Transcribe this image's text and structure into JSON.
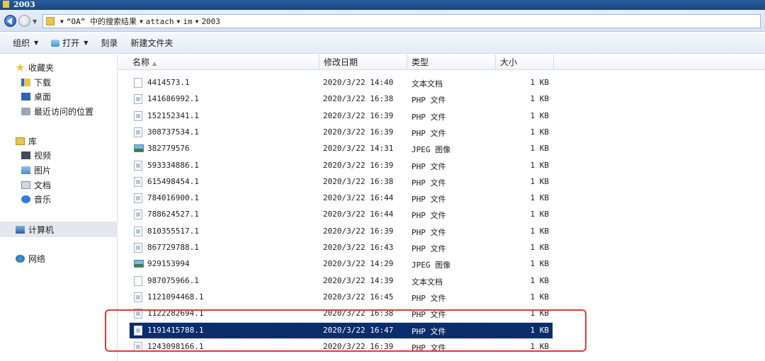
{
  "window": {
    "title": "2003"
  },
  "address": {
    "crumbs": [
      "“OA” 中的搜索结果",
      "attach",
      "im",
      "2003"
    ]
  },
  "toolbar": {
    "organize": "组织",
    "open": "打开",
    "burn": "刻录",
    "new_folder": "新建文件夹"
  },
  "navpane": {
    "favorites": "收藏夹",
    "downloads": "下载",
    "desktop": "桌面",
    "recent": "最近访问的位置",
    "libraries": "库",
    "videos": "视频",
    "pictures": "图片",
    "documents": "文档",
    "music": "音乐",
    "computer": "计算机",
    "network": "网络"
  },
  "columns": {
    "name": "名称",
    "date": "修改日期",
    "type": "类型",
    "size": "大小"
  },
  "files": [
    {
      "name": "4414573.1",
      "date": "2020/3/22 14:40",
      "type": "文本文档",
      "size": "1 KB",
      "icon": "text-doc-icon"
    },
    {
      "name": "141686992.1",
      "date": "2020/3/22 16:38",
      "type": "PHP 文件",
      "size": "1 KB",
      "icon": "php-file-icon"
    },
    {
      "name": "152152341.1",
      "date": "2020/3/22 16:39",
      "type": "PHP 文件",
      "size": "1 KB",
      "icon": "php-file-icon"
    },
    {
      "name": "308737534.1",
      "date": "2020/3/22 16:39",
      "type": "PHP 文件",
      "size": "1 KB",
      "icon": "php-file-icon"
    },
    {
      "name": "382779576",
      "date": "2020/3/22 14:31",
      "type": "JPEG 图像",
      "size": "1 KB",
      "icon": "jpeg-image-icon"
    },
    {
      "name": "593334886.1",
      "date": "2020/3/22 16:39",
      "type": "PHP 文件",
      "size": "1 KB",
      "icon": "php-file-icon"
    },
    {
      "name": "615498454.1",
      "date": "2020/3/22 16:38",
      "type": "PHP 文件",
      "size": "1 KB",
      "icon": "php-file-icon"
    },
    {
      "name": "784016900.1",
      "date": "2020/3/22 16:44",
      "type": "PHP 文件",
      "size": "1 KB",
      "icon": "php-file-icon"
    },
    {
      "name": "788624527.1",
      "date": "2020/3/22 16:44",
      "type": "PHP 文件",
      "size": "1 KB",
      "icon": "php-file-icon"
    },
    {
      "name": "810355517.1",
      "date": "2020/3/22 16:39",
      "type": "PHP 文件",
      "size": "1 KB",
      "icon": "php-file-icon"
    },
    {
      "name": "867729788.1",
      "date": "2020/3/22 16:43",
      "type": "PHP 文件",
      "size": "1 KB",
      "icon": "php-file-icon"
    },
    {
      "name": "929153994",
      "date": "2020/3/22 14:29",
      "type": "JPEG 图像",
      "size": "1 KB",
      "icon": "jpeg-image-icon"
    },
    {
      "name": "987075966.1",
      "date": "2020/3/22 14:39",
      "type": "文本文档",
      "size": "1 KB",
      "icon": "text-doc-icon"
    },
    {
      "name": "1121094468.1",
      "date": "2020/3/22 16:45",
      "type": "PHP 文件",
      "size": "1 KB",
      "icon": "php-file-icon"
    },
    {
      "name": "1122282694.1",
      "date": "2020/3/22 16:38",
      "type": "PHP 文件",
      "size": "1 KB",
      "icon": "php-file-icon"
    },
    {
      "name": "1191415788.1",
      "date": "2020/3/22 16:47",
      "type": "PHP 文件",
      "size": "1 KB",
      "icon": "php-file-icon",
      "selected": true
    },
    {
      "name": "1243098166.1",
      "date": "2020/3/22 16:39",
      "type": "PHP 文件",
      "size": "1 KB",
      "icon": "php-file-icon"
    }
  ],
  "colors": {
    "selection": "#0b2d6b",
    "annotation": "#e53935",
    "title_bar": "#1c467d"
  }
}
